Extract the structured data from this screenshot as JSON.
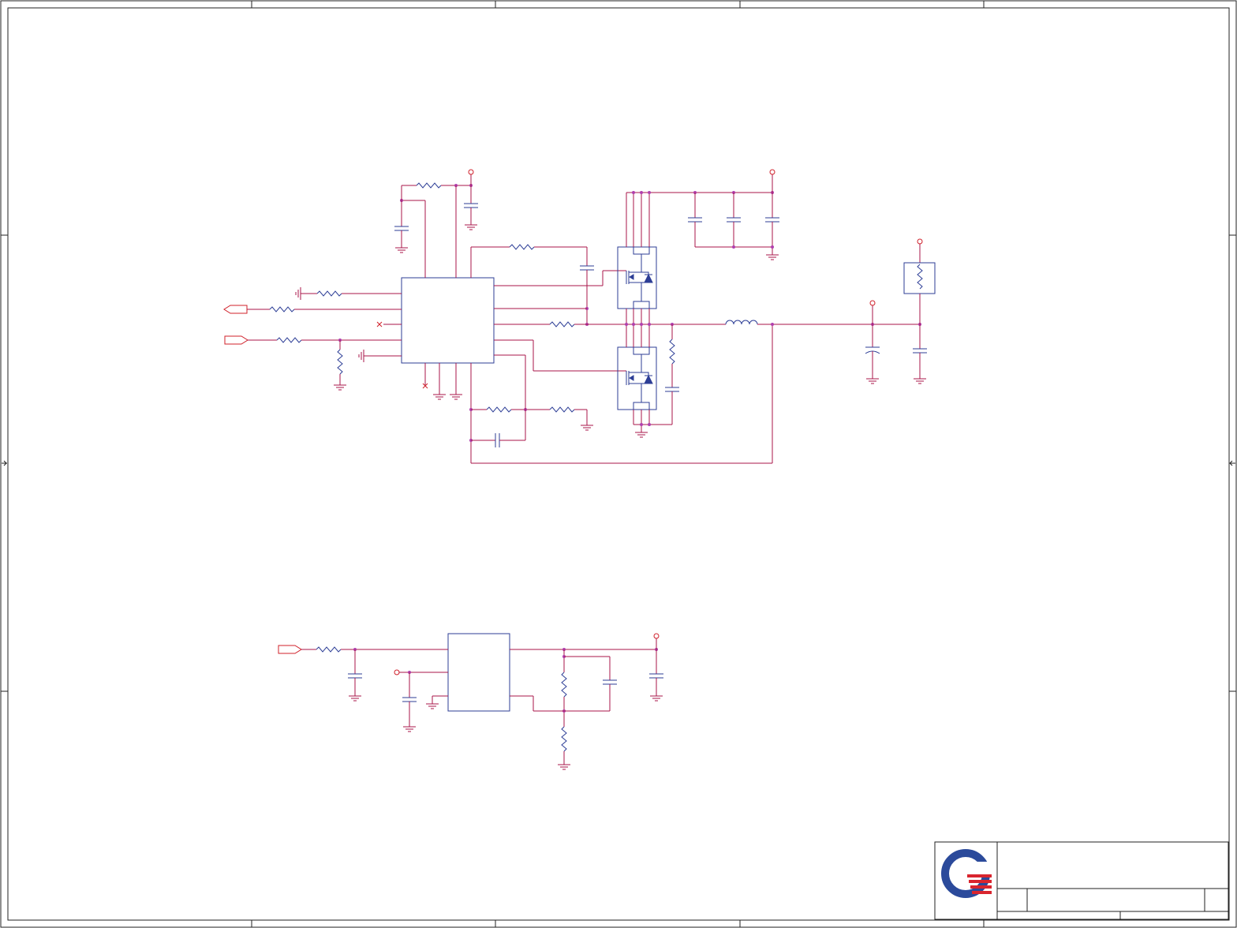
{
  "sheet": {
    "title_block": {
      "logo": "company-logo"
    }
  },
  "colors": {
    "wire": "#a8154a",
    "component": "#2d3e96",
    "power": "#d0202a",
    "junction": "#b03fae",
    "frame": "#222222",
    "logo_blue": "#2b4a9b",
    "logo_red": "#d9252e"
  }
}
